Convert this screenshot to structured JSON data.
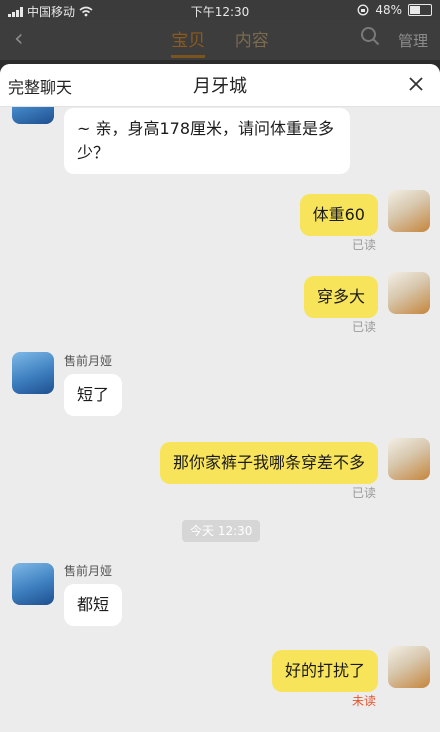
{
  "status_bar": {
    "carrier": "中国移动",
    "time": "下午12:30",
    "battery": "48%",
    "battery_level": 0.48
  },
  "background_nav": {
    "tab_active": "宝贝",
    "tab_other": "内容",
    "manage": "管理"
  },
  "sheet": {
    "left_action": "完整聊天",
    "title": "月牙城"
  },
  "messages": [
    {
      "side": "left",
      "text": "~ 亲，身高178厘米，请问体重是多少？"
    },
    {
      "side": "right",
      "text": "体重60",
      "status": "已读"
    },
    {
      "side": "right",
      "text": "穿多大",
      "status": "已读"
    },
    {
      "side": "left",
      "sender": "售前月娅",
      "text": "短了"
    },
    {
      "side": "right",
      "text": "那你家裤子我哪条穿差不多",
      "status": "已读"
    },
    {
      "side": "left",
      "sender": "售前月娅",
      "text": "都短"
    },
    {
      "side": "right",
      "text": "好的打扰了",
      "status": "未读"
    }
  ],
  "time_separator": "今天 12:30",
  "colors": {
    "incoming_bubble": "#ffffff",
    "outgoing_bubble": "#f8e45a",
    "unread": "#e4552f",
    "chat_background": "#ececec"
  }
}
